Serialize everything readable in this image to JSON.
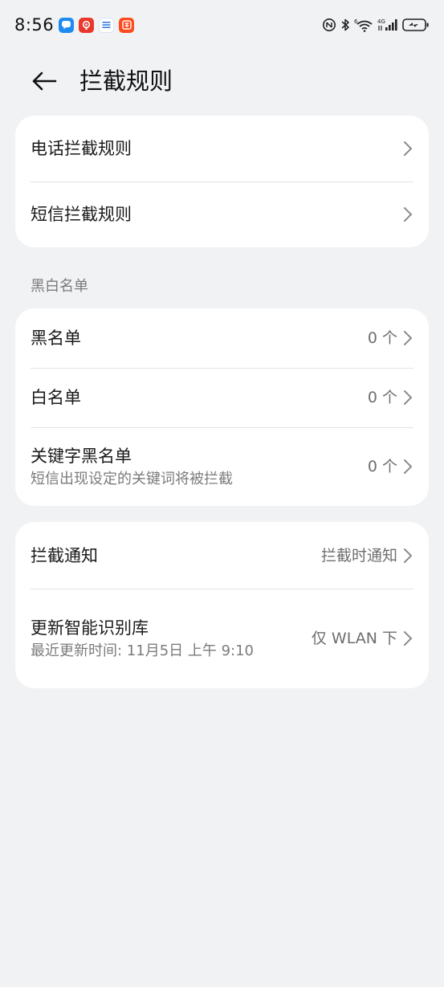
{
  "status_bar": {
    "time": "8:56",
    "app_icons": [
      "message-app-icon",
      "security-app-icon",
      "mail-app-icon",
      "taobao-app-icon"
    ],
    "network_label": "4G",
    "sim_label": "6"
  },
  "header": {
    "title": "拦截规则"
  },
  "rules_card": {
    "items": [
      {
        "label": "电话拦截规则"
      },
      {
        "label": "短信拦截规则"
      }
    ]
  },
  "blackwhite_section": {
    "label": "黑白名单",
    "items": [
      {
        "label": "黑名单",
        "value": "0 个"
      },
      {
        "label": "白名单",
        "value": "0 个"
      },
      {
        "label": "关键字黑名单",
        "subtitle": "短信出现设定的关键词将被拦截",
        "value": "0 个"
      }
    ]
  },
  "settings_card": {
    "items": [
      {
        "label": "拦截通知",
        "value": "拦截时通知"
      },
      {
        "label": "更新智能识别库",
        "subtitle": "最近更新时间: 11月5日 上午 9:10",
        "value": "仅 WLAN 下"
      }
    ]
  },
  "colors": {
    "background": "#f1f2f4",
    "card": "#ffffff",
    "divider": "#e3e3e5",
    "text_primary": "#1a1a1a",
    "text_secondary": "#7b7b7d"
  }
}
